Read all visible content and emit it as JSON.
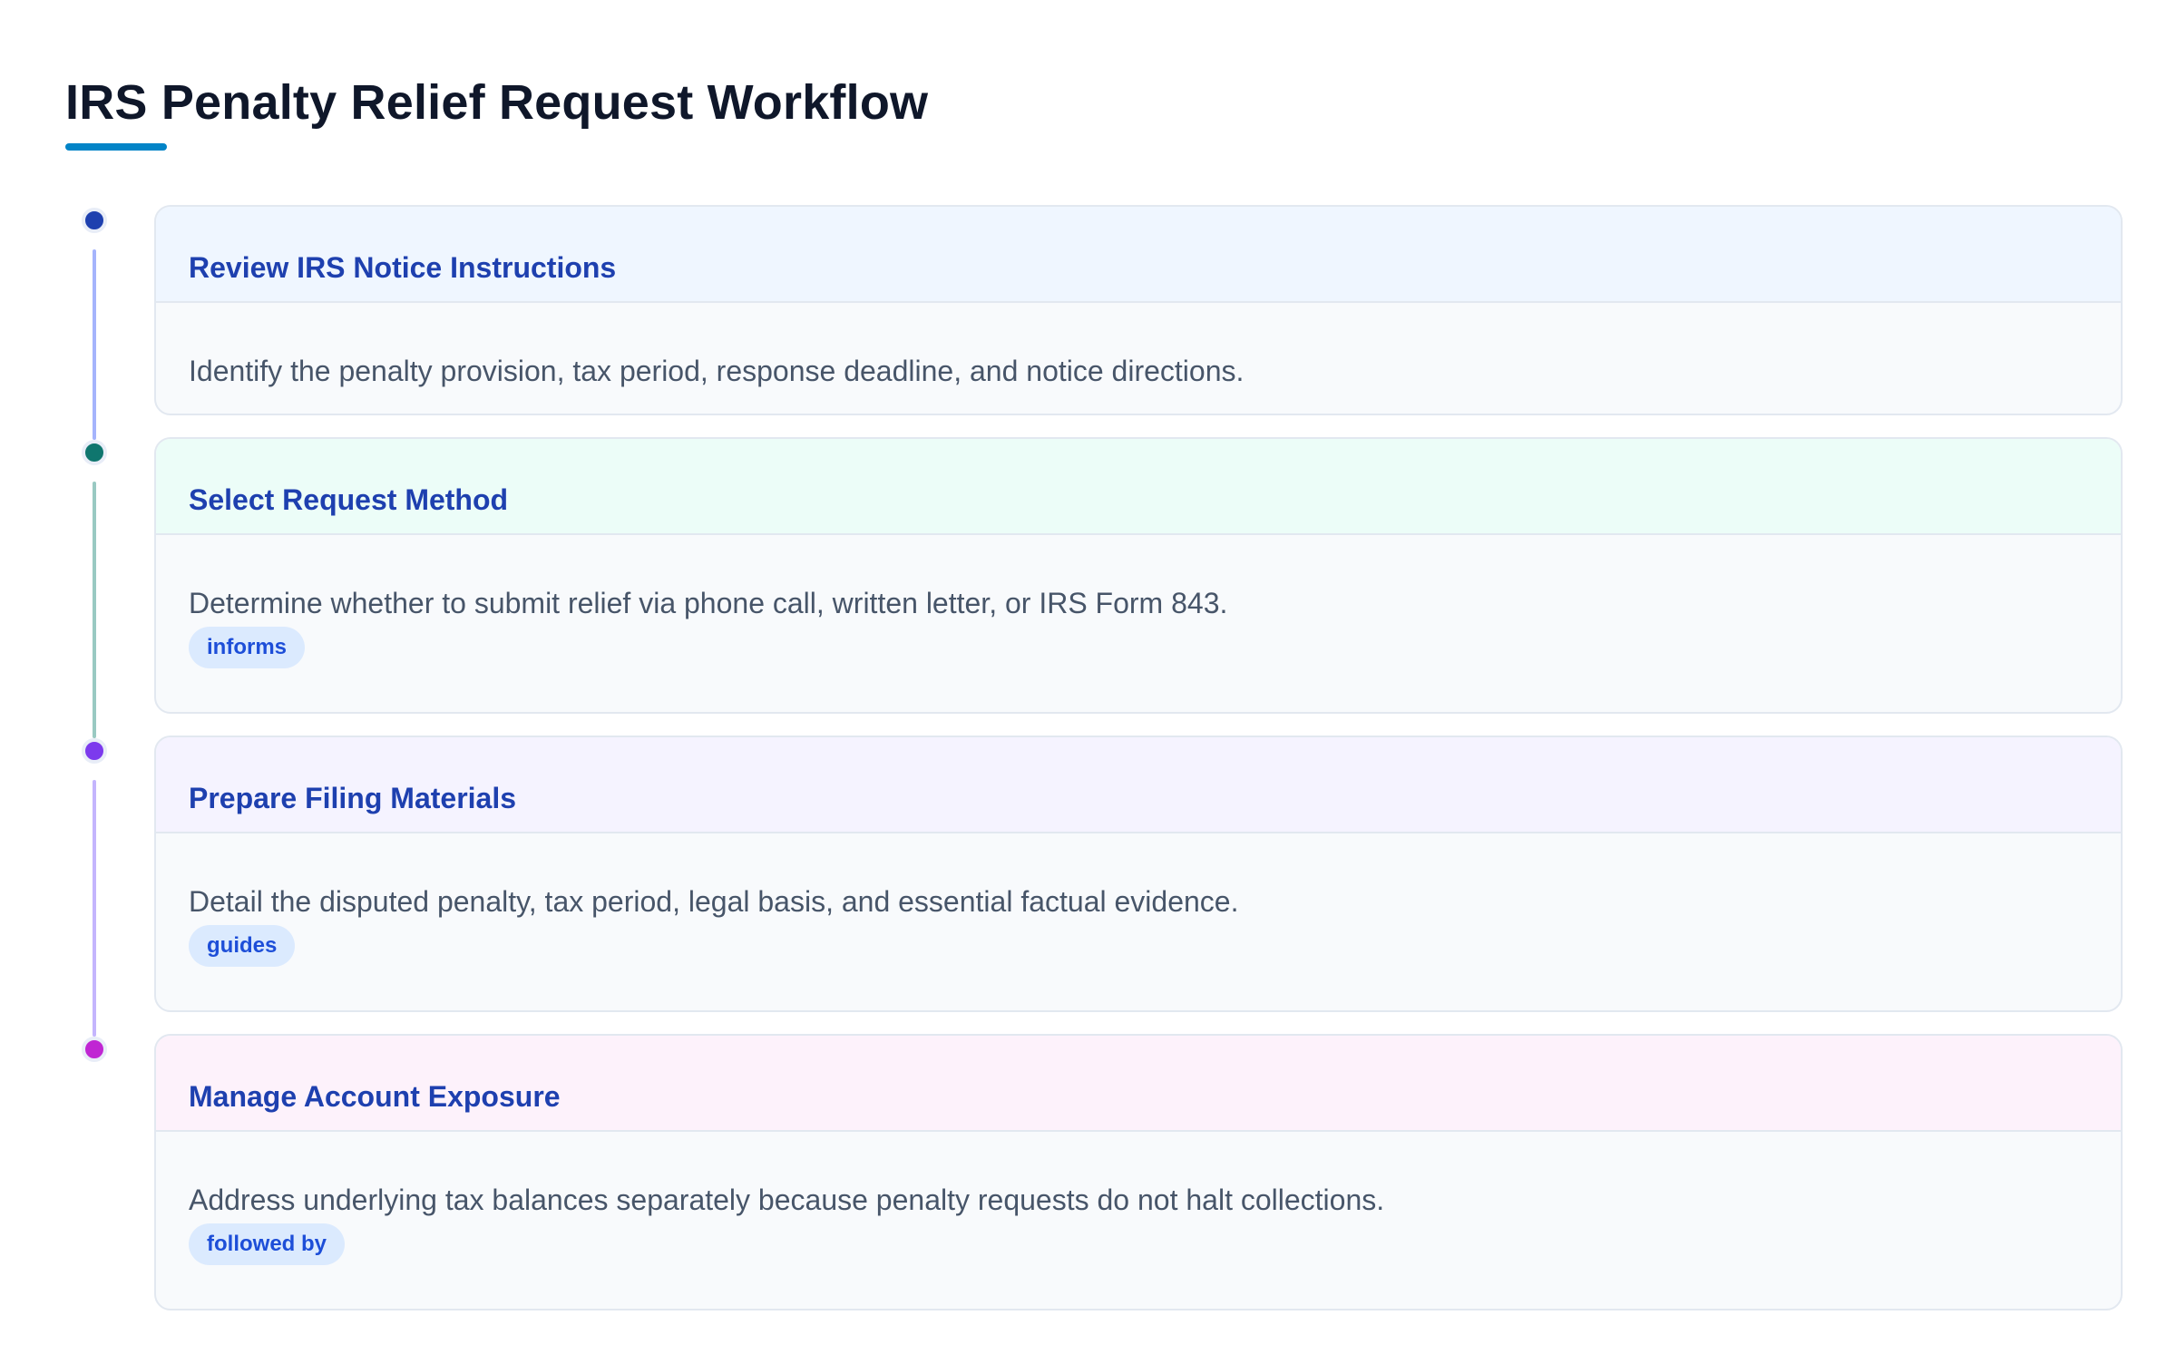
{
  "title": "IRS Penalty Relief Request Workflow",
  "accent_color": "#0284c7",
  "steps": [
    {
      "title": "Review IRS Notice Instructions",
      "description": "Identify the penalty provision, tax period, response deadline, and notice directions.",
      "badge": "",
      "dot_color": "#1e40af",
      "header_bg": "#eff6ff",
      "connector_color": "#a5b4fc"
    },
    {
      "title": "Select Request Method",
      "description": "Determine whether to submit relief via phone call, written letter, or IRS Form 843.",
      "badge": "informs",
      "dot_color": "#0f766e",
      "header_bg": "#ecfdf8",
      "connector_color": "#99c9c2"
    },
    {
      "title": "Prepare Filing Materials",
      "description": "Detail the disputed penalty, tax period, legal basis, and essential factual evidence.",
      "badge": "guides",
      "dot_color": "#7c3aed",
      "header_bg": "#f5f3ff",
      "connector_color": "#c4b5fd"
    },
    {
      "title": "Manage Account Exposure",
      "description": "Address underlying tax balances separately because penalty requests do not halt collections.",
      "badge": "followed by",
      "dot_color": "#c026d3",
      "header_bg": "#fdf2fb",
      "connector_color": ""
    }
  ]
}
